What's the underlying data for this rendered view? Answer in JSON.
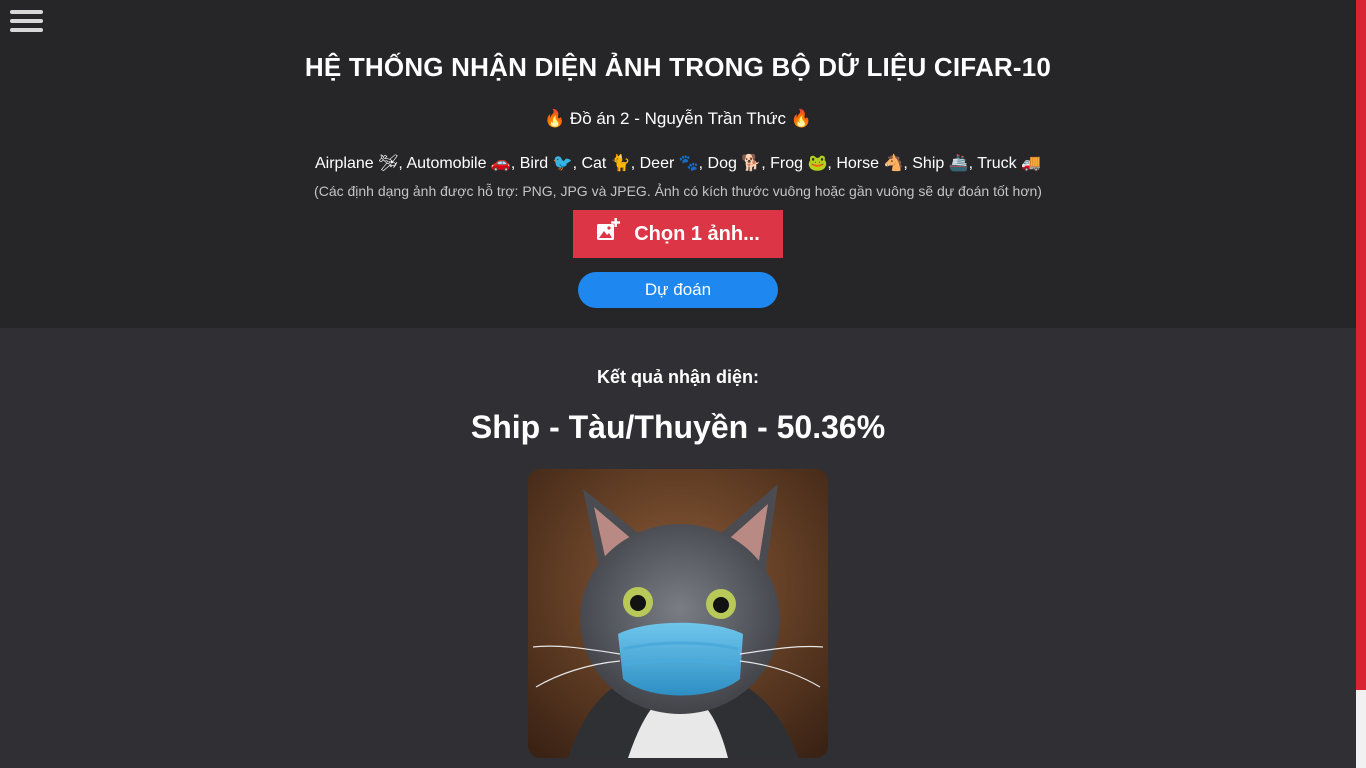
{
  "header": {
    "title": "HỆ THỐNG NHẬN DIỆN ẢNH TRONG BỘ DỮ LIỆU CIFAR-10",
    "subtitle": "🔥 Đồ án 2 - Nguyễn Trần Thức 🔥",
    "classes": "Airplane 🛩, Automobile 🚗, Bird 🐦, Cat 🐈, Deer 🐾, Dog 🐕, Frog 🐸, Horse 🐴, Ship 🚢, Truck 🚚",
    "note": "(Các định dạng ảnh được hỗ trợ: PNG, JPG và JPEG. Ảnh có kích thước vuông hoặc gần vuông sẽ dự đoán tốt hơn)"
  },
  "buttons": {
    "choose_label": "Chọn 1 ảnh...",
    "predict_label": "Dự đoán"
  },
  "result": {
    "label": "Kết quả nhận diện:",
    "value": "Ship - Tàu/Thuyền - 50.36%"
  },
  "colors": {
    "header_bg": "#262628",
    "body_bg": "#303034",
    "choose_button": "#dc3545",
    "predict_button": "#1e88f0",
    "scrollbar_thumb": "#d92332"
  },
  "icons": {
    "menu": "hamburger-menu-icon",
    "choose": "add-image-icon"
  }
}
